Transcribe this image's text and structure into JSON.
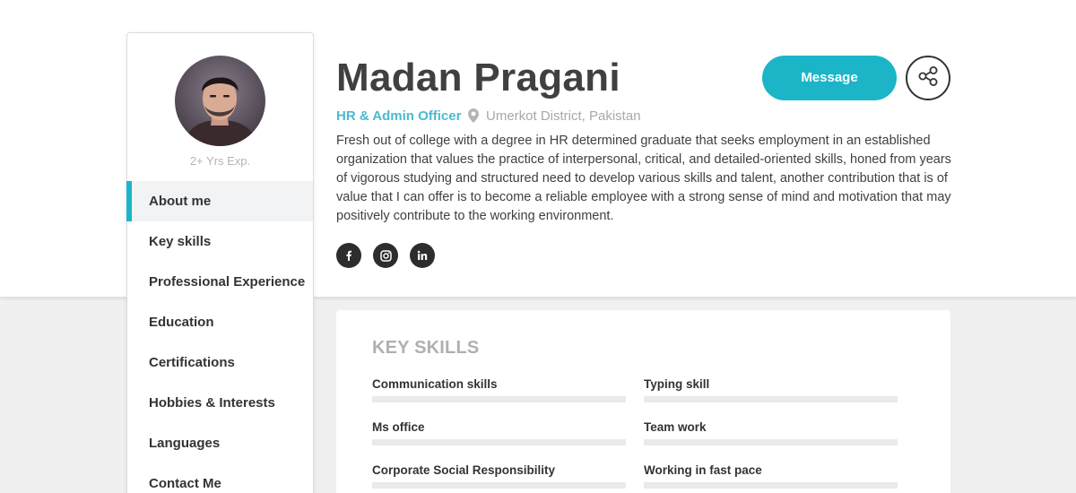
{
  "profile": {
    "name": "Madan Pragani",
    "role": "HR & Admin Officer",
    "location": "Umerkot District, Pakistan",
    "experience": "2+ Yrs Exp.",
    "bio": "Fresh out of college with a degree in HR determined graduate that seeks employment in an established organization that values the practice of interpersonal, critical, and detailed-oriented skills, honed from years of vigorous studying and structured need to develop various skills and talent, another contribution that is of value that I can offer is to become a reliable employee with a strong sense of mind and motivation that may positively contribute to the working environment."
  },
  "actions": {
    "message_label": "Message",
    "share_icon": "share-icon"
  },
  "social": [
    {
      "icon": "facebook-icon"
    },
    {
      "icon": "instagram-icon"
    },
    {
      "icon": "linkedin-icon"
    }
  ],
  "sidebar": {
    "items": [
      {
        "label": "About me",
        "active": true
      },
      {
        "label": "Key skills",
        "active": false
      },
      {
        "label": "Professional Experience",
        "active": false
      },
      {
        "label": "Education",
        "active": false
      },
      {
        "label": "Certifications",
        "active": false
      },
      {
        "label": "Hobbies & Interests",
        "active": false
      },
      {
        "label": "Languages",
        "active": false
      },
      {
        "label": "Contact Me",
        "active": false
      }
    ]
  },
  "skills_section": {
    "title": "KEY SKILLS",
    "skills": [
      {
        "label": "Communication skills",
        "level": 0
      },
      {
        "label": "Typing skill",
        "level": 0
      },
      {
        "label": "Ms office",
        "level": 0
      },
      {
        "label": "Team work",
        "level": 0
      },
      {
        "label": "Corporate Social Responsibility",
        "level": 0
      },
      {
        "label": "Working in fast pace",
        "level": 0
      }
    ]
  },
  "colors": {
    "accent": "#1cb5c8",
    "role_text": "#4bbad0",
    "page_background": "#f0f0f0",
    "track": "#eaeaea"
  }
}
